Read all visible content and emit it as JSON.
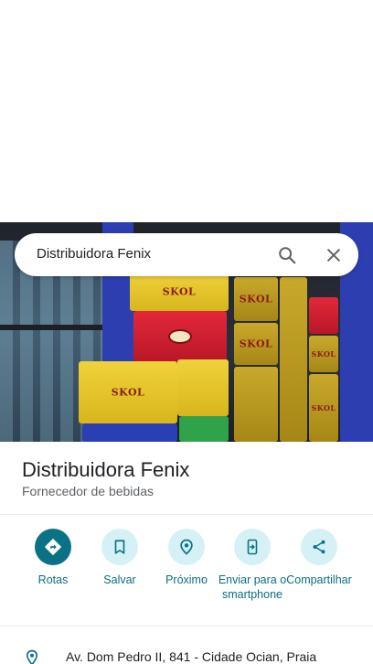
{
  "search": {
    "query": "Distribuidora Fenix"
  },
  "place": {
    "name": "Distribuidora Fenix",
    "category": "Fornecedor de bebidas",
    "address": "Av. Dom Pedro II, 841 - Cidade Ocian, Praia"
  },
  "photo": {
    "crate_labels": [
      "SKOL",
      "SKOL",
      "SKOL",
      "SKOL",
      "SKOL",
      "SKOL"
    ]
  },
  "actions": [
    {
      "label": "Rotas",
      "icon": "directions-icon"
    },
    {
      "label": "Salvar",
      "icon": "bookmark-icon"
    },
    {
      "label": "Próximo",
      "icon": "nearby-icon"
    },
    {
      "label": "Enviar para o smartphone",
      "icon": "send-to-phone-icon"
    },
    {
      "label": "Compartilhar",
      "icon": "share-icon"
    }
  ],
  "colors": {
    "accent": "#0b7285",
    "accent_light": "#d6f1f6",
    "text_secondary": "#5f6368"
  }
}
